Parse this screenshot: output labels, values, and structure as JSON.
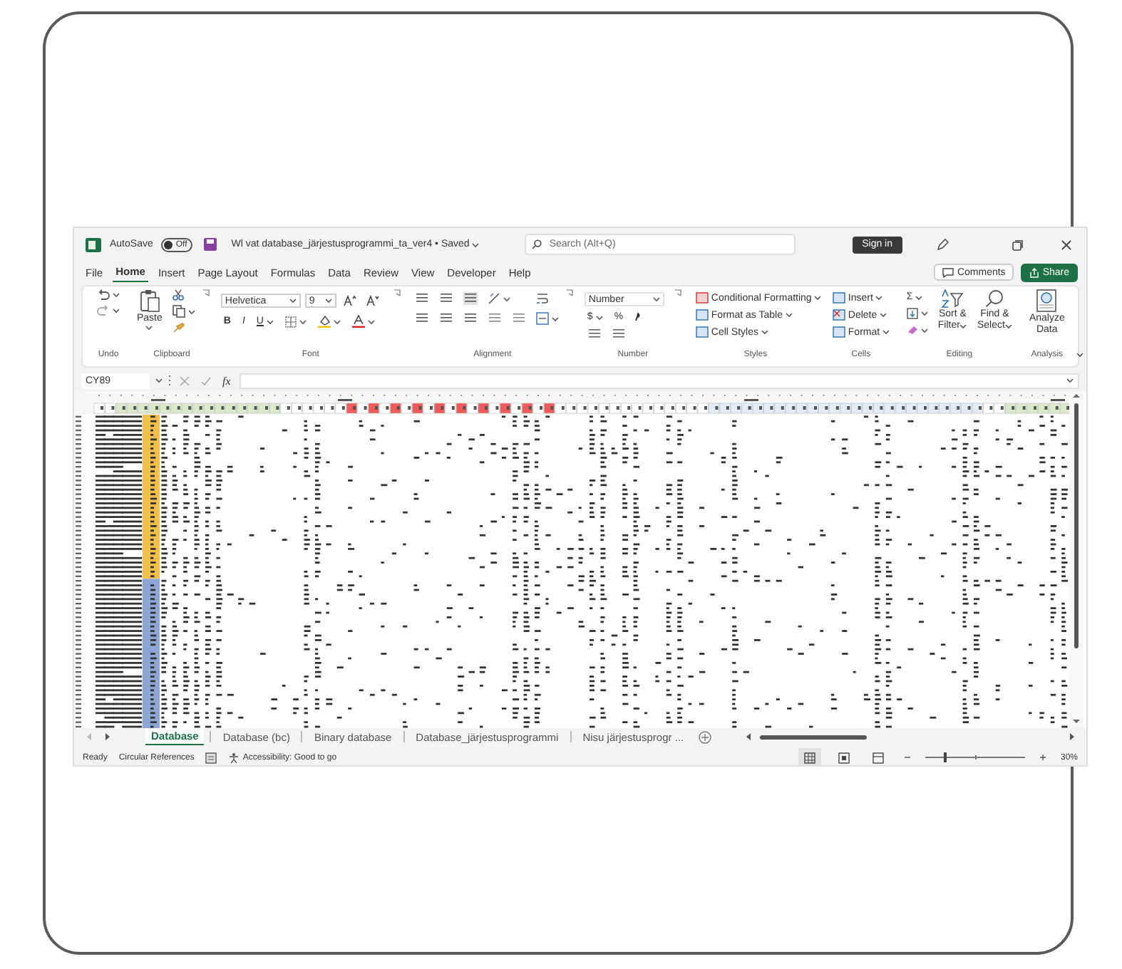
{
  "title_bar": {
    "autosave": {
      "label": "AutoSave",
      "state_text": "Off",
      "on": false
    },
    "file_name": "Wl vat database_järjestusprogrammi_ta_ver4 • Saved",
    "search": {
      "placeholder": "Search (Alt+Q)"
    },
    "sign_in": "Sign in"
  },
  "menu_tabs": [
    {
      "label": "File",
      "selected": false
    },
    {
      "label": "Home",
      "selected": true
    },
    {
      "label": "Insert",
      "selected": false
    },
    {
      "label": "Page Layout",
      "selected": false
    },
    {
      "label": "Formulas",
      "selected": false
    },
    {
      "label": "Data",
      "selected": false
    },
    {
      "label": "Review",
      "selected": false
    },
    {
      "label": "View",
      "selected": false
    },
    {
      "label": "Developer",
      "selected": false
    },
    {
      "label": "Help",
      "selected": false
    }
  ],
  "comments": "Comments",
  "share": "Share",
  "ribbon": {
    "undo": {
      "label": "Undo"
    },
    "clipboard": {
      "label": "Clipboard",
      "paste": "Paste"
    },
    "font": {
      "label": "Font",
      "font_name": "Helvetica",
      "font_size": "9",
      "bold": "B",
      "italic": "I",
      "underline": "U"
    },
    "alignment": {
      "label": "Alignment"
    },
    "number": {
      "label": "Number",
      "format": "Number",
      "currency": "$",
      "percent": "%"
    },
    "styles": {
      "label": "Styles",
      "items": [
        "Conditional Formatting",
        "Format as Table",
        "Cell Styles"
      ]
    },
    "cells": {
      "label": "Cells",
      "items": [
        "Insert",
        "Delete",
        "Format"
      ]
    },
    "editing": {
      "label": "Editing",
      "autosum": "Σ",
      "sort_filter": [
        "Sort &",
        "Filter"
      ],
      "find_select": [
        "Find &",
        "Select"
      ]
    },
    "analysis": {
      "label": "Analysis",
      "analyze": [
        "Analyze",
        "Data"
      ]
    }
  },
  "formula_bar": {
    "name_box": "CY89",
    "fx": "fx"
  },
  "sheet_tabs": [
    {
      "label": "Database",
      "selected": true
    },
    {
      "label": "Database (bc)",
      "selected": false
    },
    {
      "label": "Binary database",
      "selected": false
    },
    {
      "label": "Database_järjestusprogrammi",
      "selected": false
    },
    {
      "label": "Nisu järjestusprogr ...",
      "selected": false
    }
  ],
  "status_bar": {
    "ready": "Ready",
    "circular": "Circular References",
    "accessibility": "Accessibility: Good to go",
    "zoom": {
      "level": 0.2,
      "reading": "30%"
    }
  }
}
